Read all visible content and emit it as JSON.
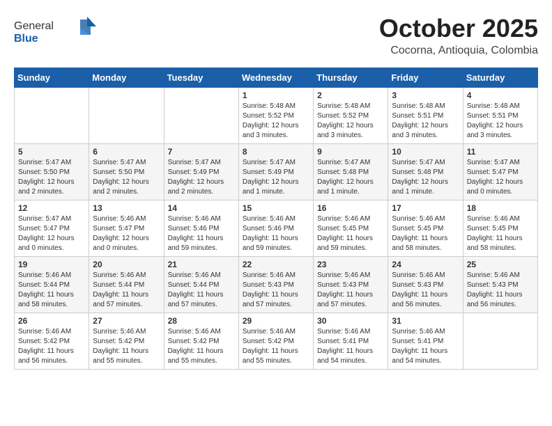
{
  "header": {
    "logo": {
      "general": "General",
      "blue": "Blue"
    },
    "month": "October 2025",
    "location": "Cocorna, Antioquia, Colombia"
  },
  "weekdays": [
    "Sunday",
    "Monday",
    "Tuesday",
    "Wednesday",
    "Thursday",
    "Friday",
    "Saturday"
  ],
  "weeks": [
    [
      {
        "day": "",
        "info": ""
      },
      {
        "day": "",
        "info": ""
      },
      {
        "day": "",
        "info": ""
      },
      {
        "day": "1",
        "info": "Sunrise: 5:48 AM\nSunset: 5:52 PM\nDaylight: 12 hours\nand 3 minutes."
      },
      {
        "day": "2",
        "info": "Sunrise: 5:48 AM\nSunset: 5:52 PM\nDaylight: 12 hours\nand 3 minutes."
      },
      {
        "day": "3",
        "info": "Sunrise: 5:48 AM\nSunset: 5:51 PM\nDaylight: 12 hours\nand 3 minutes."
      },
      {
        "day": "4",
        "info": "Sunrise: 5:48 AM\nSunset: 5:51 PM\nDaylight: 12 hours\nand 3 minutes."
      }
    ],
    [
      {
        "day": "5",
        "info": "Sunrise: 5:47 AM\nSunset: 5:50 PM\nDaylight: 12 hours\nand 2 minutes."
      },
      {
        "day": "6",
        "info": "Sunrise: 5:47 AM\nSunset: 5:50 PM\nDaylight: 12 hours\nand 2 minutes."
      },
      {
        "day": "7",
        "info": "Sunrise: 5:47 AM\nSunset: 5:49 PM\nDaylight: 12 hours\nand 2 minutes."
      },
      {
        "day": "8",
        "info": "Sunrise: 5:47 AM\nSunset: 5:49 PM\nDaylight: 12 hours\nand 1 minute."
      },
      {
        "day": "9",
        "info": "Sunrise: 5:47 AM\nSunset: 5:48 PM\nDaylight: 12 hours\nand 1 minute."
      },
      {
        "day": "10",
        "info": "Sunrise: 5:47 AM\nSunset: 5:48 PM\nDaylight: 12 hours\nand 1 minute."
      },
      {
        "day": "11",
        "info": "Sunrise: 5:47 AM\nSunset: 5:47 PM\nDaylight: 12 hours\nand 0 minutes."
      }
    ],
    [
      {
        "day": "12",
        "info": "Sunrise: 5:47 AM\nSunset: 5:47 PM\nDaylight: 12 hours\nand 0 minutes."
      },
      {
        "day": "13",
        "info": "Sunrise: 5:46 AM\nSunset: 5:47 PM\nDaylight: 12 hours\nand 0 minutes."
      },
      {
        "day": "14",
        "info": "Sunrise: 5:46 AM\nSunset: 5:46 PM\nDaylight: 11 hours\nand 59 minutes."
      },
      {
        "day": "15",
        "info": "Sunrise: 5:46 AM\nSunset: 5:46 PM\nDaylight: 11 hours\nand 59 minutes."
      },
      {
        "day": "16",
        "info": "Sunrise: 5:46 AM\nSunset: 5:45 PM\nDaylight: 11 hours\nand 59 minutes."
      },
      {
        "day": "17",
        "info": "Sunrise: 5:46 AM\nSunset: 5:45 PM\nDaylight: 11 hours\nand 58 minutes."
      },
      {
        "day": "18",
        "info": "Sunrise: 5:46 AM\nSunset: 5:45 PM\nDaylight: 11 hours\nand 58 minutes."
      }
    ],
    [
      {
        "day": "19",
        "info": "Sunrise: 5:46 AM\nSunset: 5:44 PM\nDaylight: 11 hours\nand 58 minutes."
      },
      {
        "day": "20",
        "info": "Sunrise: 5:46 AM\nSunset: 5:44 PM\nDaylight: 11 hours\nand 57 minutes."
      },
      {
        "day": "21",
        "info": "Sunrise: 5:46 AM\nSunset: 5:44 PM\nDaylight: 11 hours\nand 57 minutes."
      },
      {
        "day": "22",
        "info": "Sunrise: 5:46 AM\nSunset: 5:43 PM\nDaylight: 11 hours\nand 57 minutes."
      },
      {
        "day": "23",
        "info": "Sunrise: 5:46 AM\nSunset: 5:43 PM\nDaylight: 11 hours\nand 57 minutes."
      },
      {
        "day": "24",
        "info": "Sunrise: 5:46 AM\nSunset: 5:43 PM\nDaylight: 11 hours\nand 56 minutes."
      },
      {
        "day": "25",
        "info": "Sunrise: 5:46 AM\nSunset: 5:43 PM\nDaylight: 11 hours\nand 56 minutes."
      }
    ],
    [
      {
        "day": "26",
        "info": "Sunrise: 5:46 AM\nSunset: 5:42 PM\nDaylight: 11 hours\nand 56 minutes."
      },
      {
        "day": "27",
        "info": "Sunrise: 5:46 AM\nSunset: 5:42 PM\nDaylight: 11 hours\nand 55 minutes."
      },
      {
        "day": "28",
        "info": "Sunrise: 5:46 AM\nSunset: 5:42 PM\nDaylight: 11 hours\nand 55 minutes."
      },
      {
        "day": "29",
        "info": "Sunrise: 5:46 AM\nSunset: 5:42 PM\nDaylight: 11 hours\nand 55 minutes."
      },
      {
        "day": "30",
        "info": "Sunrise: 5:46 AM\nSunset: 5:41 PM\nDaylight: 11 hours\nand 54 minutes."
      },
      {
        "day": "31",
        "info": "Sunrise: 5:46 AM\nSunset: 5:41 PM\nDaylight: 11 hours\nand 54 minutes."
      },
      {
        "day": "",
        "info": ""
      }
    ]
  ]
}
